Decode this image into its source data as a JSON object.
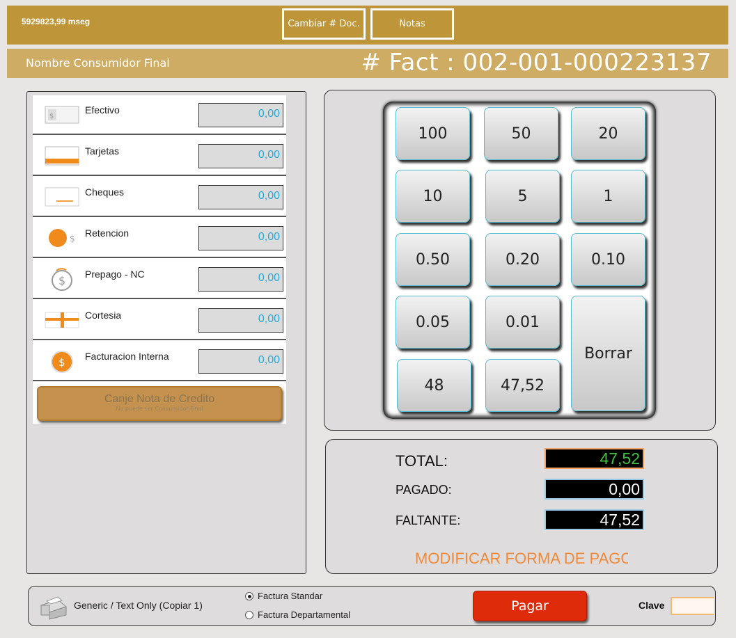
{
  "header": {
    "timer": "5929823,99 mseg",
    "change_doc_label": "Cambiar # Doc.",
    "notes_label": "Notas"
  },
  "invoice": {
    "consumer": "Nombre Consumidor Final",
    "number": "# Fact : 002-001-000223137"
  },
  "payments": [
    {
      "icon": "banknote-icon",
      "label": "Efectivo",
      "value": "0,00"
    },
    {
      "icon": "card-icon",
      "label": "Tarjetas",
      "value": "0,00"
    },
    {
      "icon": "cheque-icon",
      "label": "Cheques",
      "value": "0,00"
    },
    {
      "icon": "coin-retention-icon",
      "label": "Retencion",
      "value": "0,00"
    },
    {
      "icon": "prepaid-coin-icon",
      "label": "Prepago - NC",
      "value": "0,00"
    },
    {
      "icon": "gift-icon",
      "label": "Cortesia",
      "value": "0,00"
    },
    {
      "icon": "internal-coin-icon",
      "label": "Facturacion Interna",
      "value": "0,00"
    }
  ],
  "credit_note": {
    "label": "Canje Nota de Credito",
    "sub": "No puede ser Consumidor Final"
  },
  "keypad": [
    "100",
    "50",
    "20",
    "10",
    "5",
    "1",
    "0.50",
    "0.20",
    "0.10",
    "0.05",
    "0.01",
    "Borrar",
    "48",
    "47,52"
  ],
  "totals": {
    "total_label": "TOTAL:",
    "total_value": "47,52",
    "paid_label": "PAGADO:",
    "paid_value": "0,00",
    "missing_label": "FALTANTE:",
    "missing_value": "47,52",
    "modify_label": "MODIFICAR FORMA DE PAGO"
  },
  "bottom": {
    "printer": "Generic / Text Only (Copiar 1)",
    "radio_standard": "Factura Standar",
    "radio_departmental": "Factura Departamental",
    "selected": "Factura Standar",
    "pay_label": "Pagar",
    "password_label": "Clave"
  },
  "colors": {
    "header_gold": "#be9538",
    "namebar_gold": "#cfac63",
    "value_blue": "#2aa7d6",
    "total_green": "#3ec23e",
    "pay_red": "#de2b0a",
    "accent_orange": "#f08a3a"
  }
}
